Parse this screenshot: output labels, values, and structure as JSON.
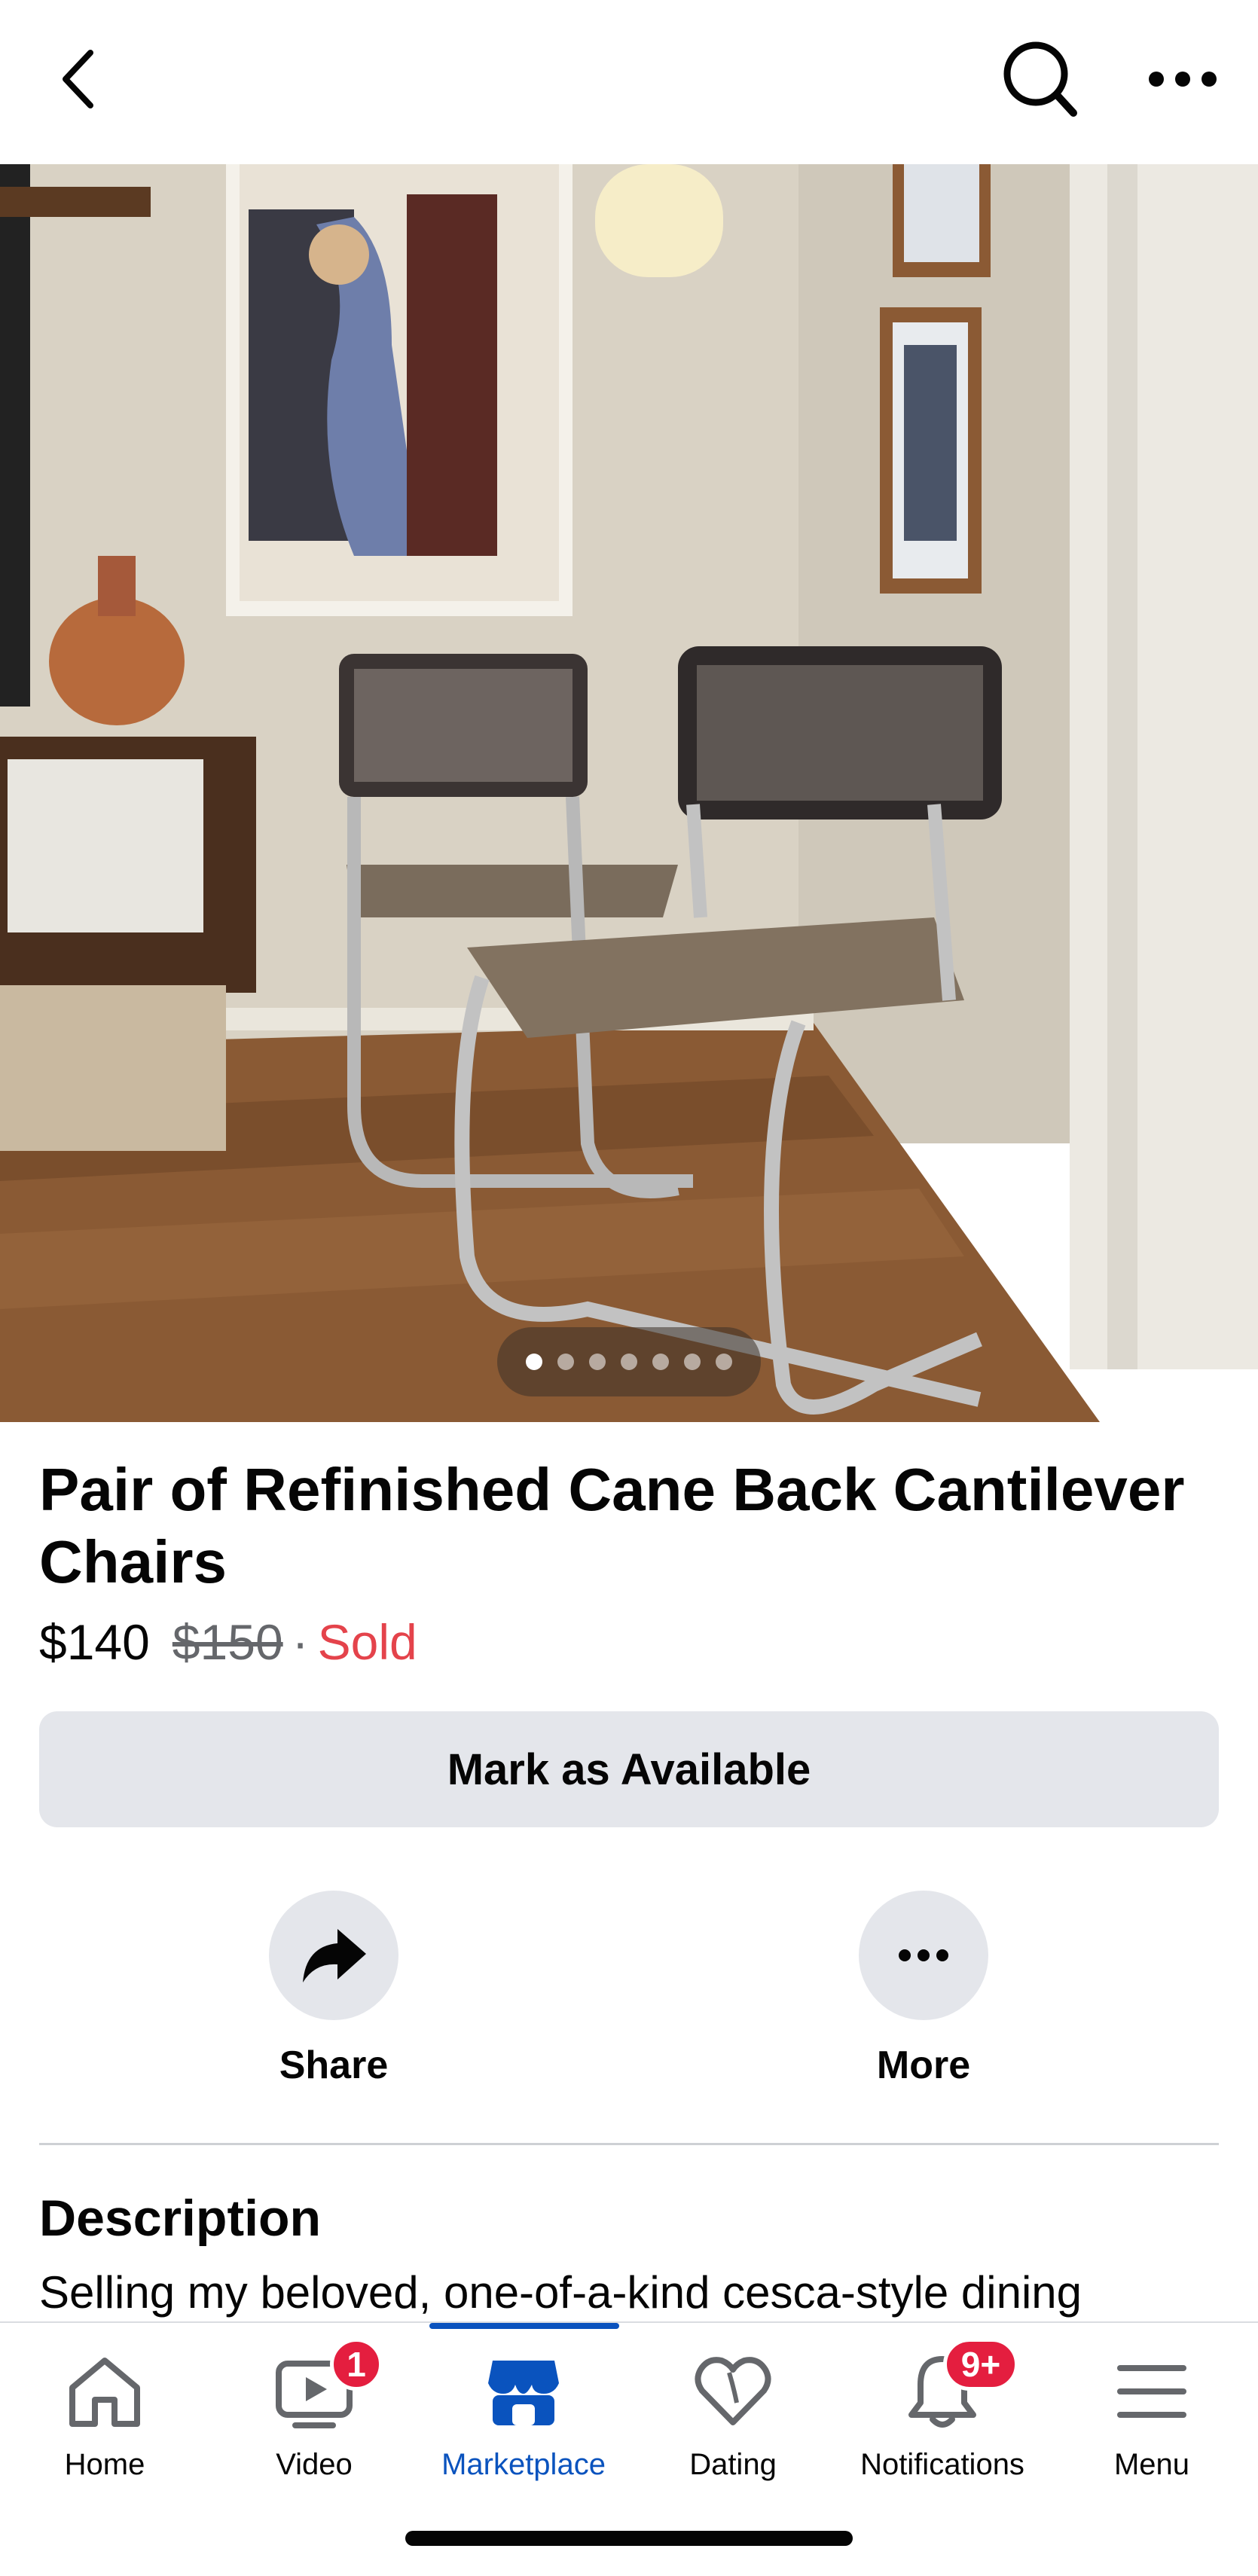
{
  "header": {
    "back_icon": "chevron-left-icon",
    "search_icon": "search-icon",
    "more_icon": "more-horizontal-icon"
  },
  "photo": {
    "total": 7,
    "current": 1
  },
  "listing": {
    "title": "Pair of Refinished Cane Back Cantilever Chairs",
    "price": "$140",
    "original_price": "$150",
    "separator": "·",
    "status": "Sold",
    "status_color": "#e4434b"
  },
  "actions": {
    "primary": "Mark as Available",
    "share": "Share",
    "more": "More"
  },
  "description": {
    "heading": "Description",
    "text": "Selling my beloved, one-of-a-kind cesca-style dining"
  },
  "tabbar": {
    "home": "Home",
    "video": "Video",
    "video_badge": "1",
    "marketplace": "Marketplace",
    "dating": "Dating",
    "notifications": "Notifications",
    "notifications_badge": "9+",
    "menu": "Menu",
    "active": "Marketplace",
    "accent": "#0a53be"
  }
}
